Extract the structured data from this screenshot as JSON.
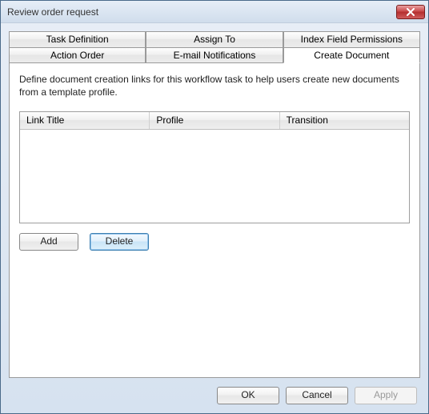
{
  "window": {
    "title": "Review order request"
  },
  "tabs": {
    "row1": [
      "Task Definition",
      "Assign To",
      "Index Field Permissions"
    ],
    "row2": [
      "Action Order",
      "E-mail Notifications",
      "Create Document"
    ],
    "active": "Create Document"
  },
  "panel": {
    "description": "Define document creation links for this workflow task to help users create new documents from a template profile.",
    "grid": {
      "columns": [
        "Link Title",
        "Profile",
        "Transition"
      ],
      "rows": []
    },
    "buttons": {
      "add": "Add",
      "delete": "Delete"
    }
  },
  "footer": {
    "ok": "OK",
    "cancel": "Cancel",
    "apply": "Apply"
  }
}
